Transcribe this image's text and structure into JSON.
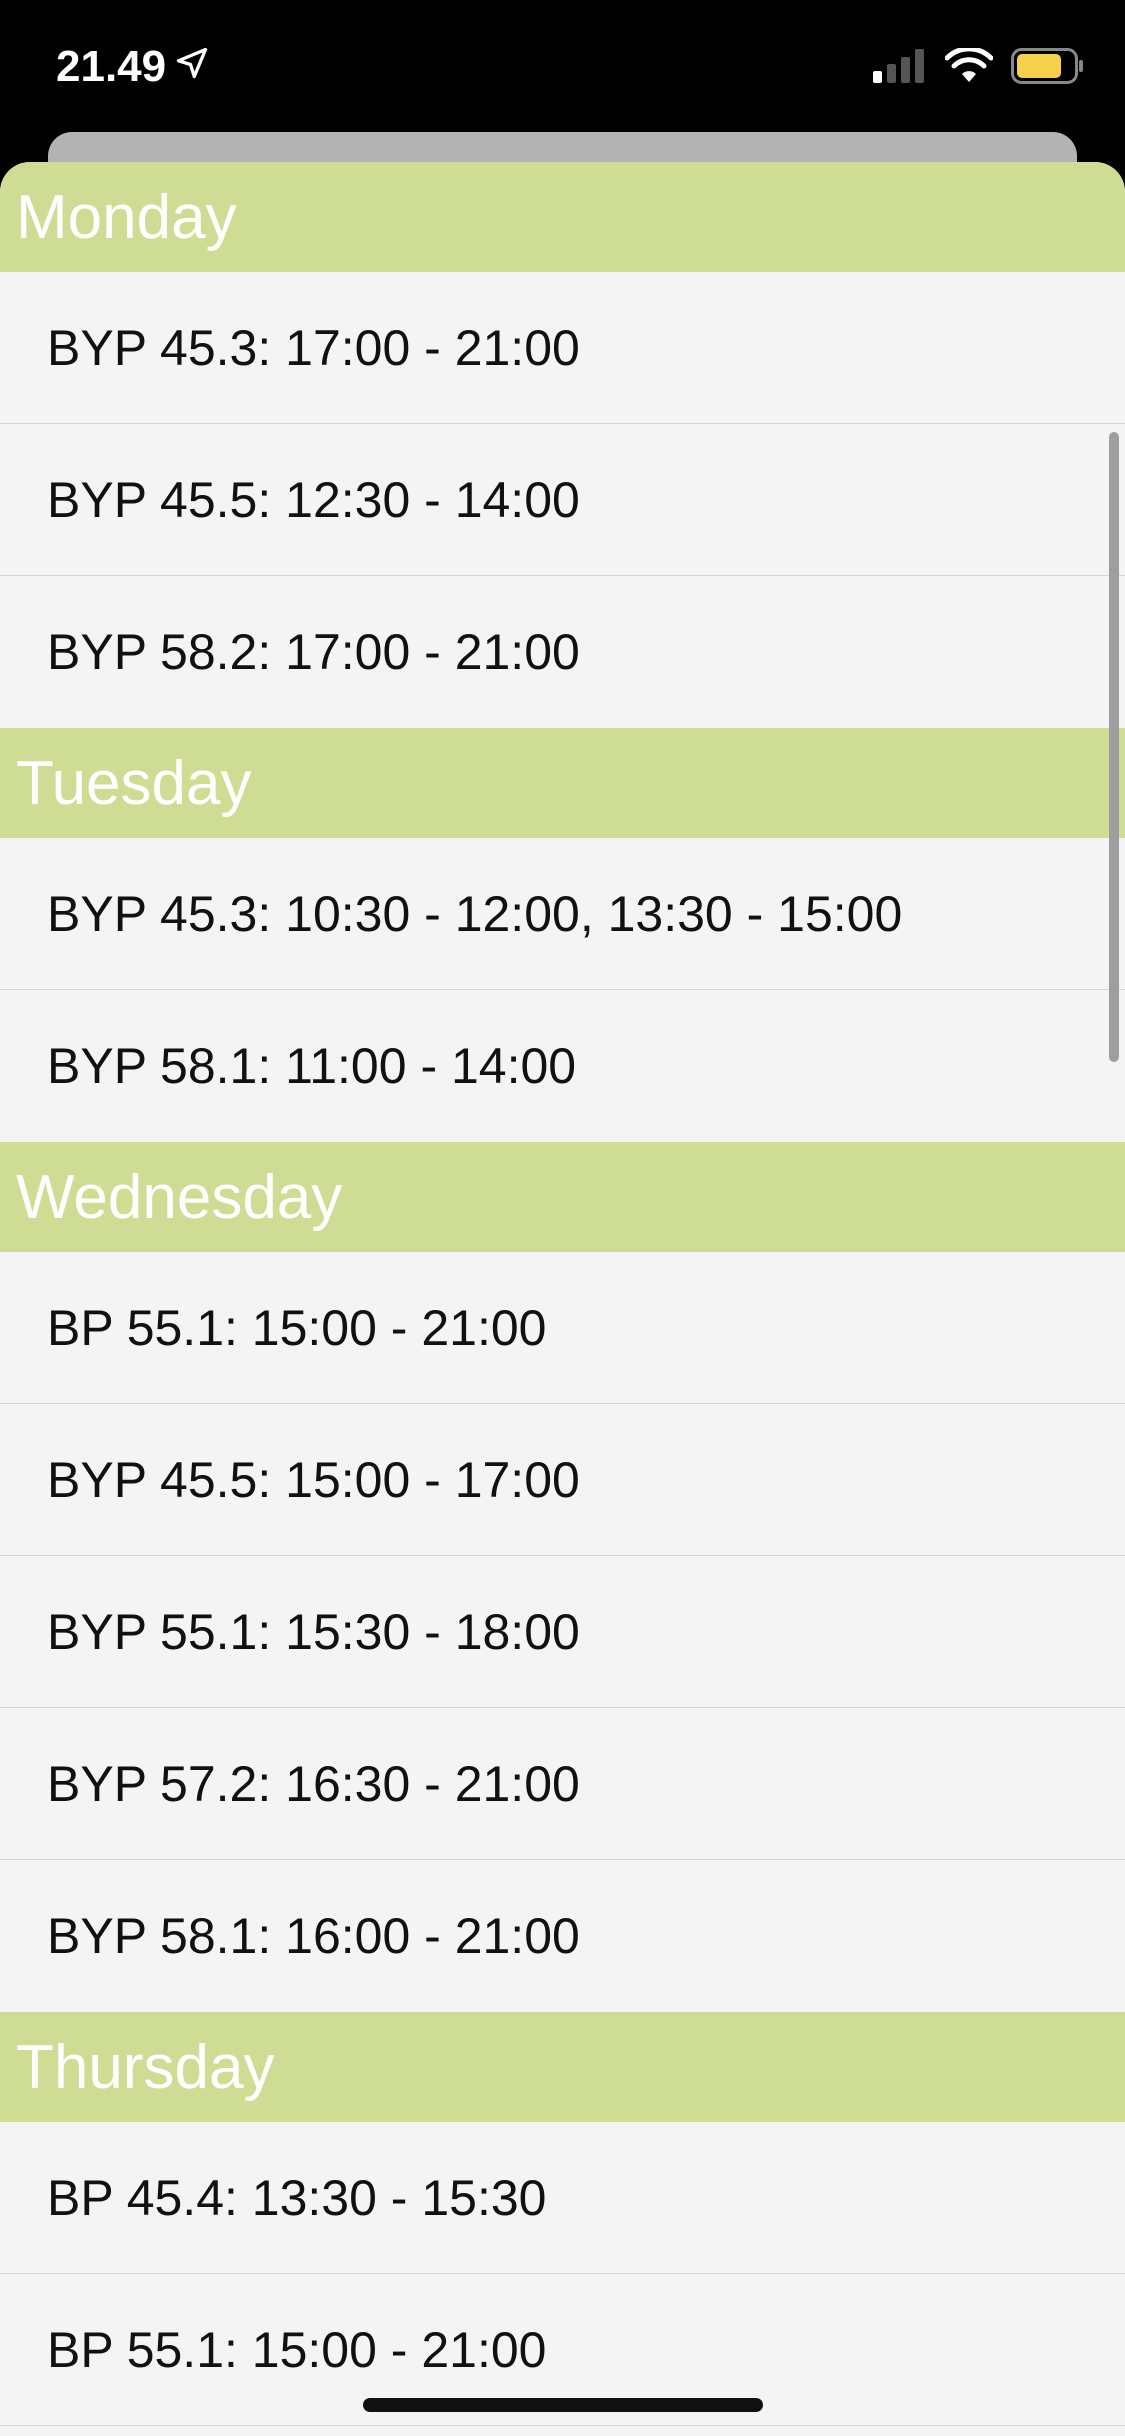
{
  "status_bar": {
    "time": "21.49",
    "icons": [
      "location-arrow-icon",
      "cellular-signal-icon",
      "wifi-icon",
      "battery-icon"
    ],
    "battery_color": "#f5d04a"
  },
  "colors": {
    "section_header_bg": "#cfdc94",
    "row_bg": "#f4f4f4"
  },
  "sections": [
    {
      "day": "Monday",
      "entries": [
        "BYP 45.3: 17:00 - 21:00",
        "BYP 45.5: 12:30 - 14:00",
        "BYP 58.2: 17:00 - 21:00"
      ]
    },
    {
      "day": "Tuesday",
      "entries": [
        "BYP 45.3: 10:30 - 12:00, 13:30 - 15:00",
        "BYP 58.1: 11:00 - 14:00"
      ]
    },
    {
      "day": "Wednesday",
      "entries": [
        "BP 55.1: 15:00 - 21:00",
        "BYP 45.5: 15:00 - 17:00",
        "BYP 55.1: 15:30 - 18:00",
        "BYP 57.2: 16:30 - 21:00",
        "BYP 58.1: 16:00 - 21:00"
      ]
    },
    {
      "day": "Thursday",
      "entries": [
        "BP 45.4: 13:30 - 15:30",
        "BP 55.1: 15:00 - 21:00"
      ]
    }
  ]
}
